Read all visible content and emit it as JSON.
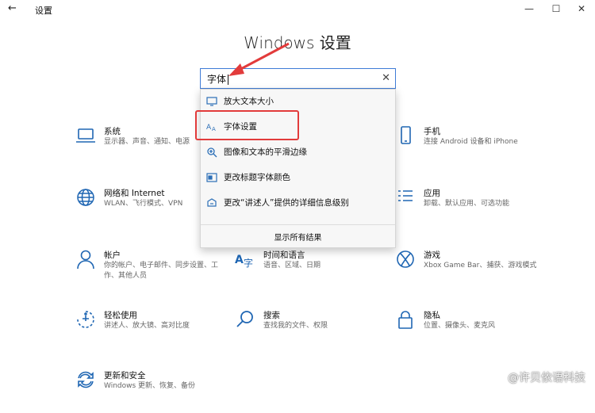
{
  "window": {
    "app_title": "设置",
    "back_glyph": "←",
    "minimize_glyph": "—",
    "maximize_glyph": "☐",
    "close_glyph": "✕"
  },
  "page": {
    "title": "Windows 设置"
  },
  "search": {
    "value": "字体",
    "clear_glyph": "✕"
  },
  "dropdown": {
    "items": [
      {
        "label": "放大文本大小",
        "icon": "monitor-icon"
      },
      {
        "label": "字体设置",
        "icon": "font-aa-icon"
      },
      {
        "label": "图像和文本的平滑边缘",
        "icon": "magnifier-icon"
      },
      {
        "label": "更改标题字体颜色",
        "icon": "color-window-icon"
      },
      {
        "label": "更改“讲述人”提供的详细信息级别",
        "icon": "narrator-icon"
      }
    ],
    "footer": "显示所有结果"
  },
  "tiles": {
    "system": {
      "title": "系统",
      "desc": "显示器、声音、通知、电源"
    },
    "phone": {
      "title": "手机",
      "desc": "连接 Android 设备和 iPhone"
    },
    "network": {
      "title": "网络和 Internet",
      "desc": "WLAN、飞行模式、VPN"
    },
    "apps": {
      "title": "应用",
      "desc": "卸载、默认应用、可选功能"
    },
    "accounts": {
      "title": "帐户",
      "desc": "你的帐户、电子邮件、同步设置、工作、其他人员"
    },
    "time": {
      "title": "时间和语言",
      "desc": "语音、区域、日期"
    },
    "gaming": {
      "title": "游戏",
      "desc": "Xbox Game Bar、捕获、游戏模式"
    },
    "ease": {
      "title": "轻松使用",
      "desc": "讲述人、放大镜、高对比度"
    },
    "search": {
      "title": "搜索",
      "desc": "查找我的文件、权限"
    },
    "privacy": {
      "title": "隐私",
      "desc": "位置、摄像头、麦克风"
    },
    "update": {
      "title": "更新和安全",
      "desc": "Windows 更新、恢复、备份"
    }
  },
  "watermark": "@许贝依语科技",
  "colors": {
    "accent": "#1f66b3",
    "search_border": "#3f7bd6",
    "annotation": "#e23b3b"
  }
}
